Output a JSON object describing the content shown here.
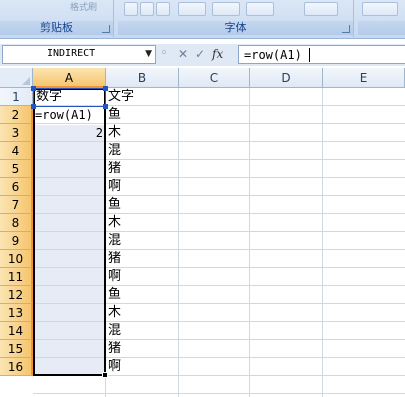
{
  "ribbon": {
    "groups": [
      {
        "label": "剪贴板"
      },
      {
        "label": "字体"
      },
      {
        "label": ""
      }
    ],
    "partial_text": "格式刷"
  },
  "formula_bar": {
    "name_box": "INDIRECT",
    "cancel_icon": "✕",
    "enter_icon": "✓",
    "fx_label": "fx",
    "formula": "=row(A1)"
  },
  "grid": {
    "columns": [
      "A",
      "B",
      "C",
      "D",
      "E"
    ],
    "rows": [
      "1",
      "2",
      "3",
      "4",
      "5",
      "6",
      "7",
      "8",
      "9",
      "10",
      "11",
      "12",
      "13",
      "14",
      "15",
      "16"
    ],
    "cells": {
      "A1": "数字",
      "B1": "文字",
      "A2": "=row(A1)",
      "A3": "2",
      "B2": "鱼",
      "B3": "木",
      "B4": "混",
      "B5": "猪",
      "B6": "啊",
      "B7": "鱼",
      "B8": "木",
      "B9": "混",
      "B10": "猪",
      "B11": "啊",
      "B12": "鱼",
      "B13": "木",
      "B14": "混",
      "B15": "猪",
      "B16": "啊"
    }
  },
  "colors": {
    "selection_header": "#f6c56f",
    "reference_border": "#2456c2",
    "grid_line": "#d0d7e5"
  }
}
